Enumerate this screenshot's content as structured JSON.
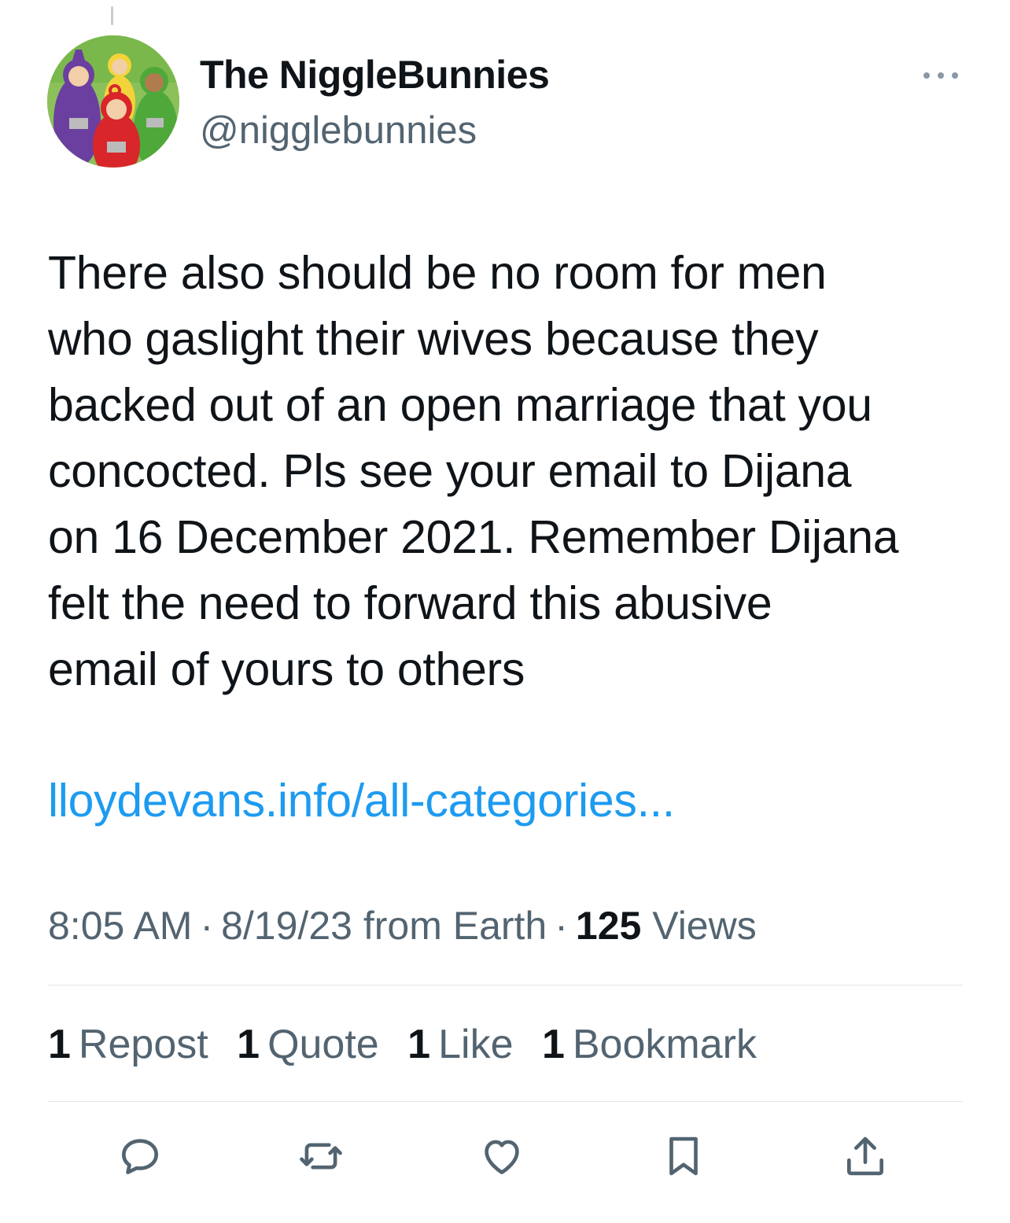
{
  "author": {
    "display_name": "The NiggleBunnies",
    "handle": "@nigglebunnies"
  },
  "tweet": {
    "text": "There also should be no room for men\nwho gaslight their wives because they\nbacked out of an open marriage that you\nconcocted. Pls see your email to Dijana\non 16 December 2021. Remember Dijana\nfelt the need to forward this abusive\nemail of yours to others",
    "link_text": "lloydevans.info/all-categories..."
  },
  "meta": {
    "time": "8:05 AM",
    "separator": "·",
    "date": "8/19/23",
    "source": "from Earth",
    "views_count": "125",
    "views_label": "Views"
  },
  "stats": {
    "reposts": {
      "count": "1",
      "label": "Repost"
    },
    "quotes": {
      "count": "1",
      "label": "Quote"
    },
    "likes": {
      "count": "1",
      "label": "Like"
    },
    "bookmarks": {
      "count": "1",
      "label": "Bookmark"
    }
  },
  "actions": [
    "reply-icon",
    "repost-icon",
    "like-icon",
    "bookmark-icon",
    "share-icon"
  ],
  "colors": {
    "text": "#0f1419",
    "secondary": "#536471",
    "link": "#1d9bf0",
    "divider": "#e1e6ea"
  }
}
